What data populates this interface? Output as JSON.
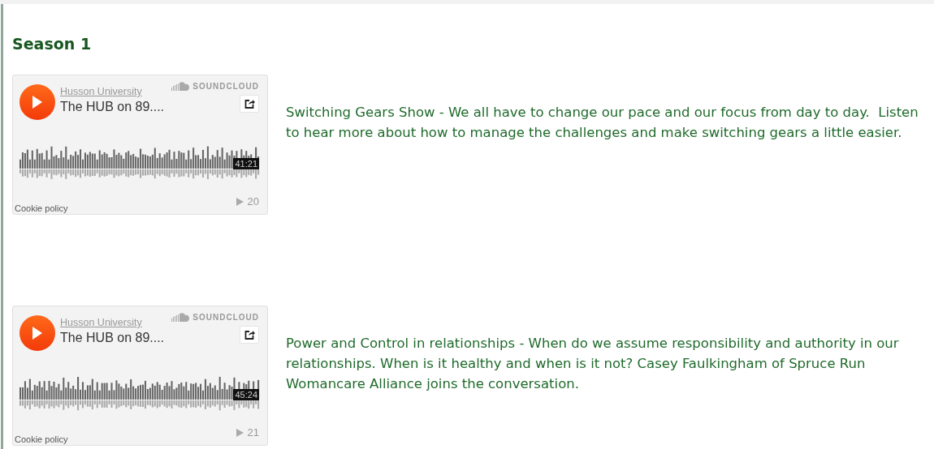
{
  "heading": "Season 1",
  "episodes": [
    {
      "player": {
        "artist": "Husson University",
        "title": "The HUB on 89....",
        "brand": "SOUNDCLOUD",
        "duration": "41:21",
        "plays": "20",
        "cookie": "Cookie policy"
      },
      "description": "Switching Gears Show - We all have to change our pace and our focus from day to day.  Listen to hear more about how to manage the challenges and make switching gears a little easier."
    },
    {
      "player": {
        "artist": "Husson University",
        "title": "The HUB on 89....",
        "brand": "SOUNDCLOUD",
        "duration": "45:24",
        "plays": "21",
        "cookie": "Cookie policy"
      },
      "description": "Power and Control in relationships - When do we assume responsibility and authority in our relationships. When is it healthy and when is it not? Casey Faulkingham of Spruce Run Womancare Alliance joins the conversation."
    }
  ]
}
